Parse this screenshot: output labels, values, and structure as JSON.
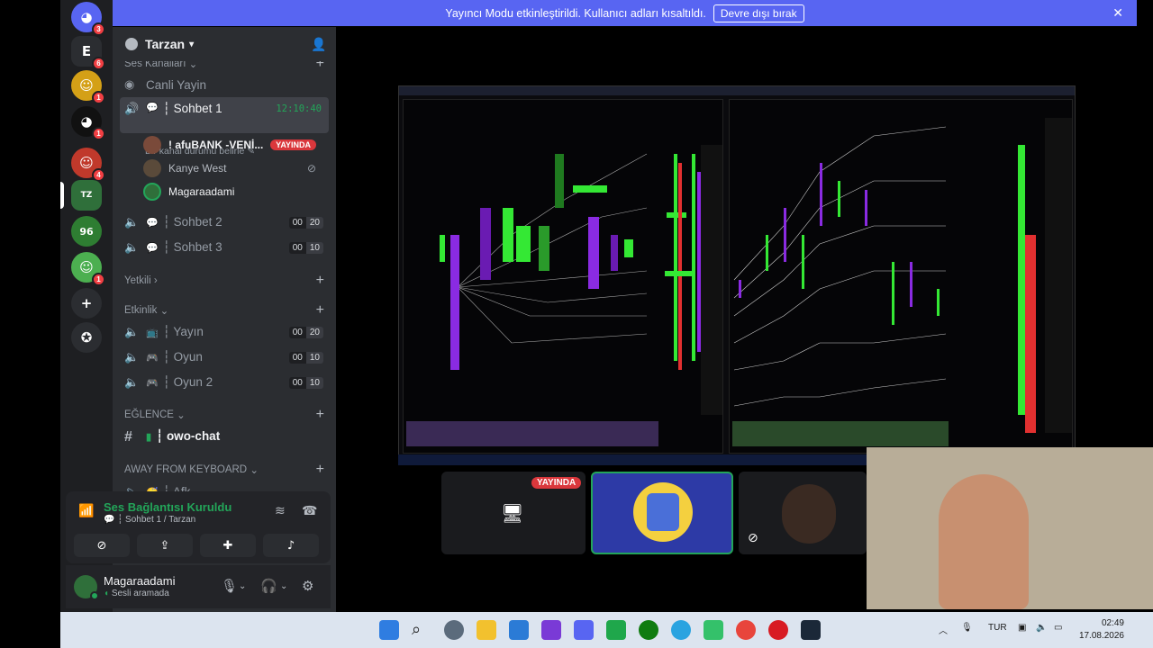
{
  "notice": {
    "text": "Yayıncı Modu etkinleştirildi. Kullanıcı adları kısaltıldı.",
    "button": "Devre dışı bırak",
    "close": "✕"
  },
  "rail": {
    "servers": [
      {
        "name": "discord-home",
        "badge": "3",
        "color": "#5865f2"
      },
      {
        "name": "server-e",
        "badge": "6",
        "color": "#2b2d31"
      },
      {
        "name": "server-avatar-1",
        "badge": "1",
        "color": "#d4a017"
      },
      {
        "name": "server-discord-2",
        "badge": "1",
        "color": "#111"
      },
      {
        "name": "server-avatar-2",
        "badge": "4",
        "color": "#c0392b"
      },
      {
        "name": "server-tarzan",
        "badge": "",
        "color": "#2f6f3a"
      },
      {
        "name": "server-96",
        "badge": "",
        "color": "#2e7d32"
      },
      {
        "name": "server-avatar-3",
        "badge": "1",
        "color": "#4caf50"
      }
    ]
  },
  "sidebar": {
    "server_name": "Tarzan",
    "categories": {
      "ses": "Ses Kanalları",
      "yetkili": "Yetkili",
      "etkinlik": "Etkinlik",
      "eglence": "EĞLENCE",
      "afk": "AWAY FROM KEYBOARD"
    },
    "channels": {
      "canli": "Canli Yayin",
      "sohbet1": "┆ Sohbet 1",
      "sohbet1_timer": "12:10:40",
      "sohbet1_status": "Bir kanal durumu belirle",
      "sohbet2": "┆ Sohbet 2",
      "sohbet2_a": "00",
      "sohbet2_b": "20",
      "sohbet3": "┆ Sohbet 3",
      "sohbet3_a": "00",
      "sohbet3_b": "10",
      "yayin": "┆ Yayın",
      "yayin_a": "00",
      "yayin_b": "20",
      "oyun": "┆ Oyun",
      "oyun_a": "00",
      "oyun_b": "10",
      "oyun2": "┆ Oyun 2",
      "oyun2_a": "00",
      "oyun2_b": "10",
      "owo": "┆ owo-chat",
      "afk": "┆ Afk"
    },
    "members": [
      {
        "name": "! afuBANK -VENİ...",
        "live": "YAYINDA"
      },
      {
        "name": "Kanye West",
        "live": ""
      },
      {
        "name": "Magaraadami",
        "live": ""
      }
    ]
  },
  "voice": {
    "title": "Ses Bağlantısı Kuruldu",
    "sub": "┆ Sohbet 1 / Tarzan"
  },
  "user": {
    "name": "Magaraadami",
    "status": "Sesli aramada"
  },
  "tiles": {
    "live_badge": "YAYINDA"
  },
  "tray": {
    "lang": "TUR",
    "time": "02:49",
    "date": "17.08.2026"
  },
  "colors": {
    "accent": "#5865f2",
    "green": "#23a559",
    "red": "#da373c"
  }
}
